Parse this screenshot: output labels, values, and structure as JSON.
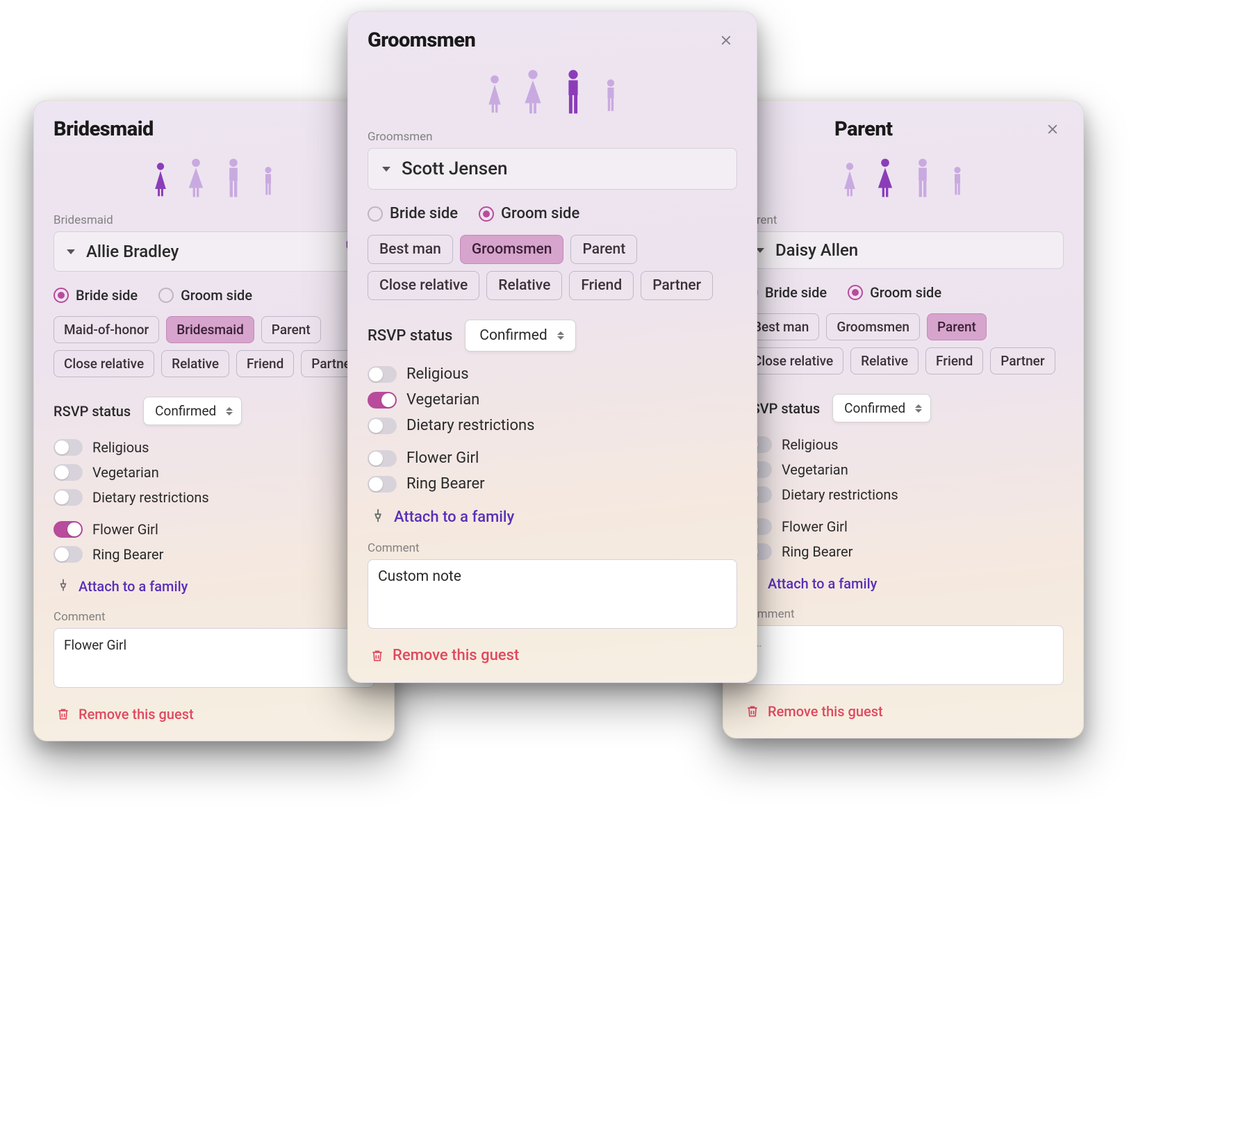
{
  "labels": {
    "rsvp": "RSVP status",
    "rsvp_value": "Confirmed",
    "bride_side": "Bride side",
    "groom_side": "Groom side",
    "attach": "Attach to a family",
    "comment": "Comment",
    "remove": "Remove this guest",
    "toggles": {
      "religious": "Religious",
      "vegetarian": "Vegetarian",
      "dietary": "Dietary restrictions",
      "flower_girl": "Flower Girl",
      "ring_bearer": "Ring Bearer"
    }
  },
  "cards": {
    "left": {
      "title": "Bridesmaid",
      "role_label": "Bridesmaid",
      "name": "Allie Bradley",
      "side": "bride",
      "tags": [
        "Maid-of-honor",
        "Bridesmaid",
        "Parent",
        "Close relative",
        "Relative",
        "Friend",
        "Partner"
      ],
      "selected_tag": "Bridesmaid",
      "toggles": {
        "religious": false,
        "vegetarian": false,
        "dietary": false,
        "flower_girl": true,
        "ring_bearer": false
      },
      "comment": "Flower Girl",
      "show_flower_icon": true
    },
    "center": {
      "title": "Groomsmen",
      "role_label": "Groomsmen",
      "name": "Scott Jensen",
      "side": "groom",
      "tags": [
        "Best man",
        "Groomsmen",
        "Parent",
        "Close relative",
        "Relative",
        "Friend",
        "Partner"
      ],
      "selected_tag": "Groomsmen",
      "toggles": {
        "religious": false,
        "vegetarian": true,
        "dietary": false,
        "flower_girl": false,
        "ring_bearer": false
      },
      "comment": "Custom note",
      "show_flower_icon": false
    },
    "right": {
      "title": "Parent",
      "role_label": "Parent",
      "name": "Daisy Allen",
      "side": "groom",
      "tags": [
        "Best man",
        "Groomsmen",
        "Parent",
        "Close relative",
        "Relative",
        "Friend",
        "Partner"
      ],
      "selected_tag": "Parent",
      "toggles": {
        "religious": false,
        "vegetarian": false,
        "dietary": false,
        "flower_girl": false,
        "ring_bearer": false
      },
      "comment": "",
      "comment_placeholder": "…",
      "show_flower_icon": false
    }
  }
}
